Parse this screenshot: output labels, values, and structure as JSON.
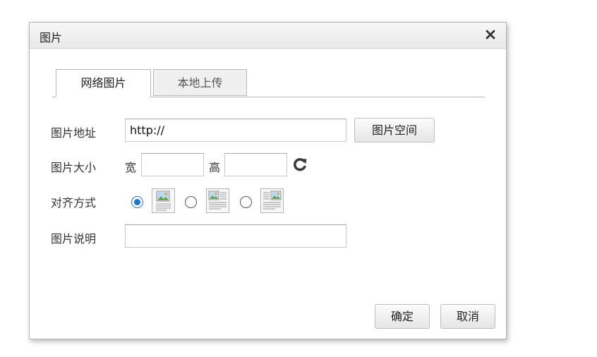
{
  "dialog": {
    "title": "图片",
    "close_icon": "close-icon"
  },
  "tabs": [
    {
      "label": "网络图片",
      "active": true
    },
    {
      "label": "本地上传",
      "active": false
    }
  ],
  "form": {
    "url": {
      "label": "图片地址",
      "value": "http://",
      "space_button": "图片空间"
    },
    "size": {
      "label": "图片大小",
      "width_label": "宽",
      "width_value": "",
      "height_label": "高",
      "height_value": "",
      "reset_icon": "refresh-icon"
    },
    "align": {
      "label": "对齐方式",
      "options": [
        {
          "icon": "align-default-icon",
          "checked": true
        },
        {
          "icon": "align-left-icon",
          "checked": false
        },
        {
          "icon": "align-right-icon",
          "checked": false
        }
      ]
    },
    "description": {
      "label": "图片说明",
      "value": ""
    }
  },
  "footer": {
    "confirm": "确定",
    "cancel": "取消"
  },
  "colors": {
    "accent": "#1f74cf"
  }
}
